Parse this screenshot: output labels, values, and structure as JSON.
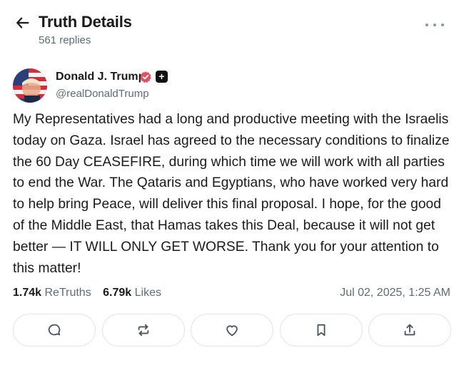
{
  "header": {
    "title": "Truth Details",
    "reply_count": "561 replies"
  },
  "post": {
    "author_name": "Donald J. Trump",
    "handle": "@realDonaldTrump",
    "body": "My Representatives had a long and productive meeting with the Israelis today on Gaza. Israel has agreed to the necessary conditions to finalize the 60 Day CEASEFIRE, during which time we will work with all parties to end the War. The Qataris and Egyptians, who have worked very hard to help bring Peace, will deliver this final proposal. I hope, for the good of the Middle East, that Hamas takes this Deal, because it will not get better — IT WILL ONLY GET WORSE. Thank you for your attention to this matter!",
    "retruths_count": "1.74k",
    "retruths_label": "ReTruths",
    "likes_count": "6.79k",
    "likes_label": "Likes",
    "timestamp": "Jul 02, 2025, 1:25 AM"
  },
  "actions": [
    {
      "name": "reply",
      "icon": "comment-icon"
    },
    {
      "name": "retruth",
      "icon": "repost-icon"
    },
    {
      "name": "like",
      "icon": "heart-icon"
    },
    {
      "name": "bookmark",
      "icon": "bookmark-icon"
    },
    {
      "name": "share",
      "icon": "share-icon"
    }
  ],
  "colors": {
    "text": "#1a1a1a",
    "muted": "#5f6b77",
    "verified_badge": "#e24f60",
    "border": "#e1e5ea"
  }
}
